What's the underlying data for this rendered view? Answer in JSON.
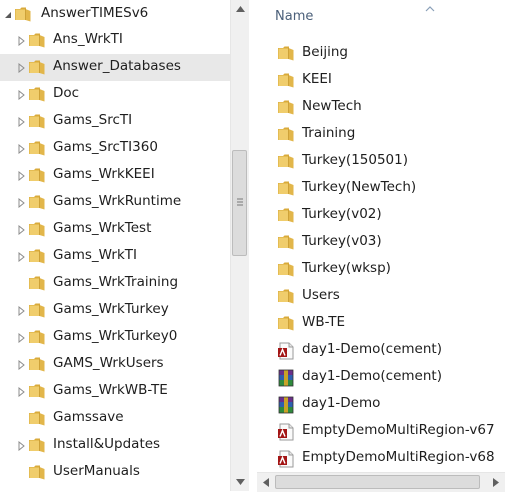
{
  "tree": {
    "root": {
      "label": "AnswerTIMESv6",
      "icon": "folder-icon"
    },
    "items": [
      {
        "label": "Ans_WrkTI",
        "has_children": true
      },
      {
        "label": "Answer_Databases",
        "has_children": true,
        "selected": true
      },
      {
        "label": "Doc",
        "has_children": true
      },
      {
        "label": "Gams_SrcTI",
        "has_children": true
      },
      {
        "label": "Gams_SrcTI360",
        "has_children": true
      },
      {
        "label": "Gams_WrkKEEI",
        "has_children": true
      },
      {
        "label": "Gams_WrkRuntime",
        "has_children": true
      },
      {
        "label": "Gams_WrkTest",
        "has_children": true
      },
      {
        "label": "Gams_WrkTI",
        "has_children": true
      },
      {
        "label": "Gams_WrkTraining",
        "has_children": false
      },
      {
        "label": "Gams_WrkTurkey",
        "has_children": true
      },
      {
        "label": "Gams_WrkTurkey0",
        "has_children": true
      },
      {
        "label": "GAMS_WrkUsers",
        "has_children": true
      },
      {
        "label": "Gams_WrkWB-TE",
        "has_children": true
      },
      {
        "label": "Gamssave",
        "has_children": false
      },
      {
        "label": "Install&Updates",
        "has_children": true
      },
      {
        "label": "UserManuals",
        "has_children": false
      }
    ]
  },
  "content": {
    "column_header": "Name",
    "files": [
      {
        "label": "Beijing",
        "icon": "folder-icon"
      },
      {
        "label": "KEEI",
        "icon": "folder-icon"
      },
      {
        "label": "NewTech",
        "icon": "folder-icon"
      },
      {
        "label": "Training",
        "icon": "folder-icon"
      },
      {
        "label": "Turkey(150501)",
        "icon": "folder-icon"
      },
      {
        "label": "Turkey(NewTech)",
        "icon": "folder-icon"
      },
      {
        "label": "Turkey(v02)",
        "icon": "folder-icon"
      },
      {
        "label": "Turkey(v03)",
        "icon": "folder-icon"
      },
      {
        "label": "Turkey(wksp)",
        "icon": "folder-icon"
      },
      {
        "label": "Users",
        "icon": "folder-icon"
      },
      {
        "label": "WB-TE",
        "icon": "folder-icon"
      },
      {
        "label": "day1-Demo(cement)",
        "icon": "access-database-icon"
      },
      {
        "label": "day1-Demo(cement)",
        "icon": "rar-archive-icon"
      },
      {
        "label": "day1-Demo",
        "icon": "rar-archive-icon"
      },
      {
        "label": "EmptyDemoMultiRegion-v67",
        "icon": "access-database-icon"
      },
      {
        "label": "EmptyDemoMultiRegion-v68",
        "icon": "access-database-icon"
      }
    ]
  },
  "colors": {
    "folder": "#e8c25a",
    "selection": "#e8e8e8",
    "header_text": "#4c607a",
    "scrollbar": "#f0f0f0"
  }
}
